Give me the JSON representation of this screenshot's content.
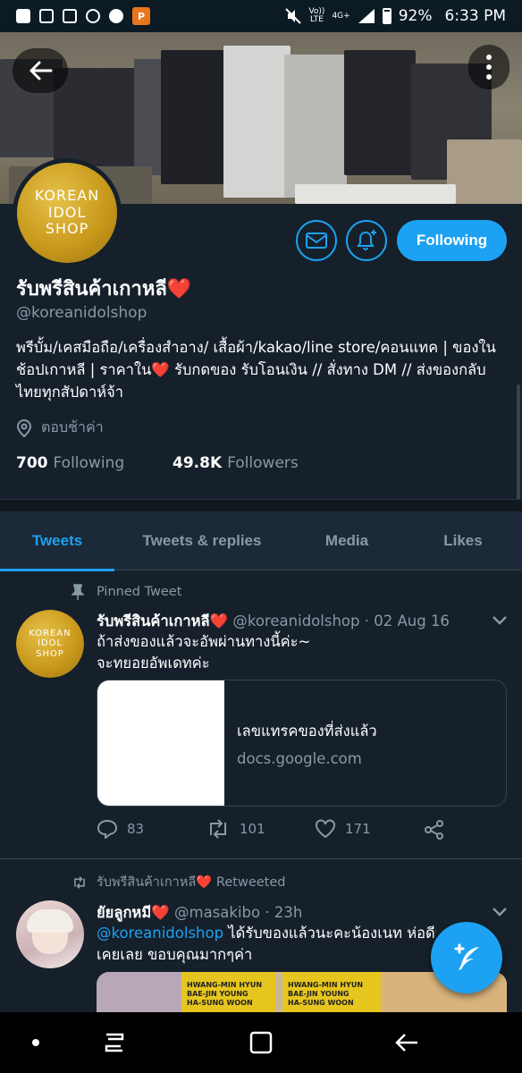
{
  "status_bar": {
    "app_icon_label": "P",
    "volte": "Vo))\nLTE",
    "signal_label": "4G+",
    "battery": "92%",
    "time": "6:33 PM"
  },
  "header": {
    "back_icon": "arrow-left-icon",
    "more_icon": "more-vertical-icon"
  },
  "profile": {
    "avatar_text": [
      "KOREAN",
      "IDOL",
      "SHOP"
    ],
    "name": "รับพรีสินค้าเกาหลี❤️",
    "handle": "@koreanidolshop",
    "bio": "พรีบั้ม/เคสมือถือ/เครื่องสำอาง/ เสื้อผ้า/kakao/line store/คอนแทค | ของในช้อปเกาหลี | ราคาใน❤️ รับกดของ รับโอนเงิน // สั่งทาง DM // ส่งของกลับไทยทุกสัปดาห์จ้า",
    "location": "ตอบช้าค่า",
    "following_count": "700",
    "following_label": "Following",
    "followers_count": "49.8K",
    "followers_label": "Followers",
    "follow_button": "Following",
    "message_icon": "envelope-icon",
    "notify_icon": "bell-plus-icon"
  },
  "tabs": [
    {
      "label": "Tweets",
      "active": true
    },
    {
      "label": "Tweets & replies",
      "active": false
    },
    {
      "label": "Media",
      "active": false
    },
    {
      "label": "Likes",
      "active": false
    }
  ],
  "tweets": [
    {
      "context": "Pinned Tweet",
      "author": "รับพรีสินค้าเกาหลี❤️",
      "handle": "@koreanidolshop",
      "date": "02 Aug 16",
      "text_line1": "ถ้าส่งของแล้วจะอัพผ่านทางนี้ค่ะ~",
      "text_line2": "จะทยอยอัพเดทค่ะ",
      "card_title": "เลขแทรคของที่ส่งแล้ว",
      "card_domain": "docs.google.com",
      "replies": "83",
      "retweets": "101",
      "likes": "171"
    },
    {
      "context": "รับพรีสินค้าเกาหลี❤️ Retweeted",
      "author": "ยัยลูกหมี❤️",
      "handle": "@masakibo",
      "date": "23h",
      "mention": "@koreanidolshop",
      "text_line1_rest": " ได้รับของแล้วนะคะน้องเนท ห่อดีมาก",
      "text_line2": "เคยเลย ขอบคุณมากๆค่า",
      "photo_names": [
        "HWANG-MIN HYUN",
        "BAE-JIN YOUNG",
        "HA-SUNG WOON"
      ]
    }
  ],
  "colors": {
    "accent": "#1da1f2",
    "background": "#15202b",
    "secondary_text": "#8899a6",
    "like": "#e0245e"
  }
}
